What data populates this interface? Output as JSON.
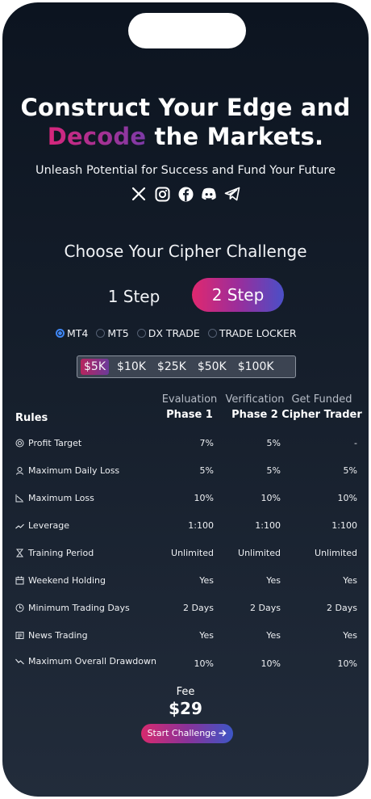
{
  "hero": {
    "title_line1": "Construct Your Edge and",
    "title_accent": "Decode",
    "title_rest": " the Markets.",
    "subtitle": "Unleash Potential for Success and Fund Your Future"
  },
  "socials": [
    "x-icon",
    "instagram-icon",
    "facebook-icon",
    "discord-icon",
    "telegram-icon"
  ],
  "challenge": {
    "heading": "Choose Your Cipher Challenge",
    "steps": [
      {
        "label": "1 Step",
        "selected": false
      },
      {
        "label": "2 Step",
        "selected": true
      }
    ],
    "platforms": [
      {
        "label": "MT4",
        "selected": true
      },
      {
        "label": "MT5",
        "selected": false
      },
      {
        "label": "DX TRADE",
        "selected": false
      },
      {
        "label": "TRADE LOCKER",
        "selected": false
      }
    ],
    "sizes": [
      {
        "label": "$5K",
        "selected": true
      },
      {
        "label": "$10K",
        "selected": false
      },
      {
        "label": "$25K",
        "selected": false
      },
      {
        "label": "$50K",
        "selected": false
      },
      {
        "label": "$100K",
        "selected": false
      }
    ]
  },
  "table": {
    "rules_header": "Rules",
    "columns": [
      {
        "top": "Evaluation",
        "bottom": "Phase 1"
      },
      {
        "top": "Verification",
        "bottom": "Phase 2"
      },
      {
        "top": "Get Funded",
        "bottom": "Cipher Trader"
      }
    ],
    "rows": [
      {
        "label": "Profit Target",
        "icon": "target-icon",
        "values": [
          "7%",
          "5%",
          "-"
        ]
      },
      {
        "label": "Maximum Daily Loss",
        "icon": "daily-loss-icon",
        "values": [
          "5%",
          "5%",
          "5%"
        ]
      },
      {
        "label": "Maximum Loss",
        "icon": "chart-down-icon",
        "values": [
          "10%",
          "10%",
          "10%"
        ]
      },
      {
        "label": "Leverage",
        "icon": "leverage-icon",
        "values": [
          "1:100",
          "1:100",
          "1:100"
        ]
      },
      {
        "label": "Training Period",
        "icon": "hourglass-icon",
        "values": [
          "Unlimited",
          "Unlimited",
          "Unlimited"
        ]
      },
      {
        "label": "Weekend Holding",
        "icon": "calendar-icon",
        "values": [
          "Yes",
          "Yes",
          "Yes"
        ]
      },
      {
        "label": "Minimum Trading Days",
        "icon": "clock-icon",
        "values": [
          "2 Days",
          "2 Days",
          "2 Days"
        ]
      },
      {
        "label": "News Trading",
        "icon": "newspaper-icon",
        "values": [
          "Yes",
          "Yes",
          "Yes"
        ]
      },
      {
        "label": "Maximum Overall Drawdown",
        "icon": "trend-down-icon",
        "values": [
          "10%",
          "10%",
          "10%"
        ]
      }
    ]
  },
  "fee": {
    "label": "Fee",
    "value": "$29"
  },
  "cta": {
    "label": "Start Challenge"
  }
}
